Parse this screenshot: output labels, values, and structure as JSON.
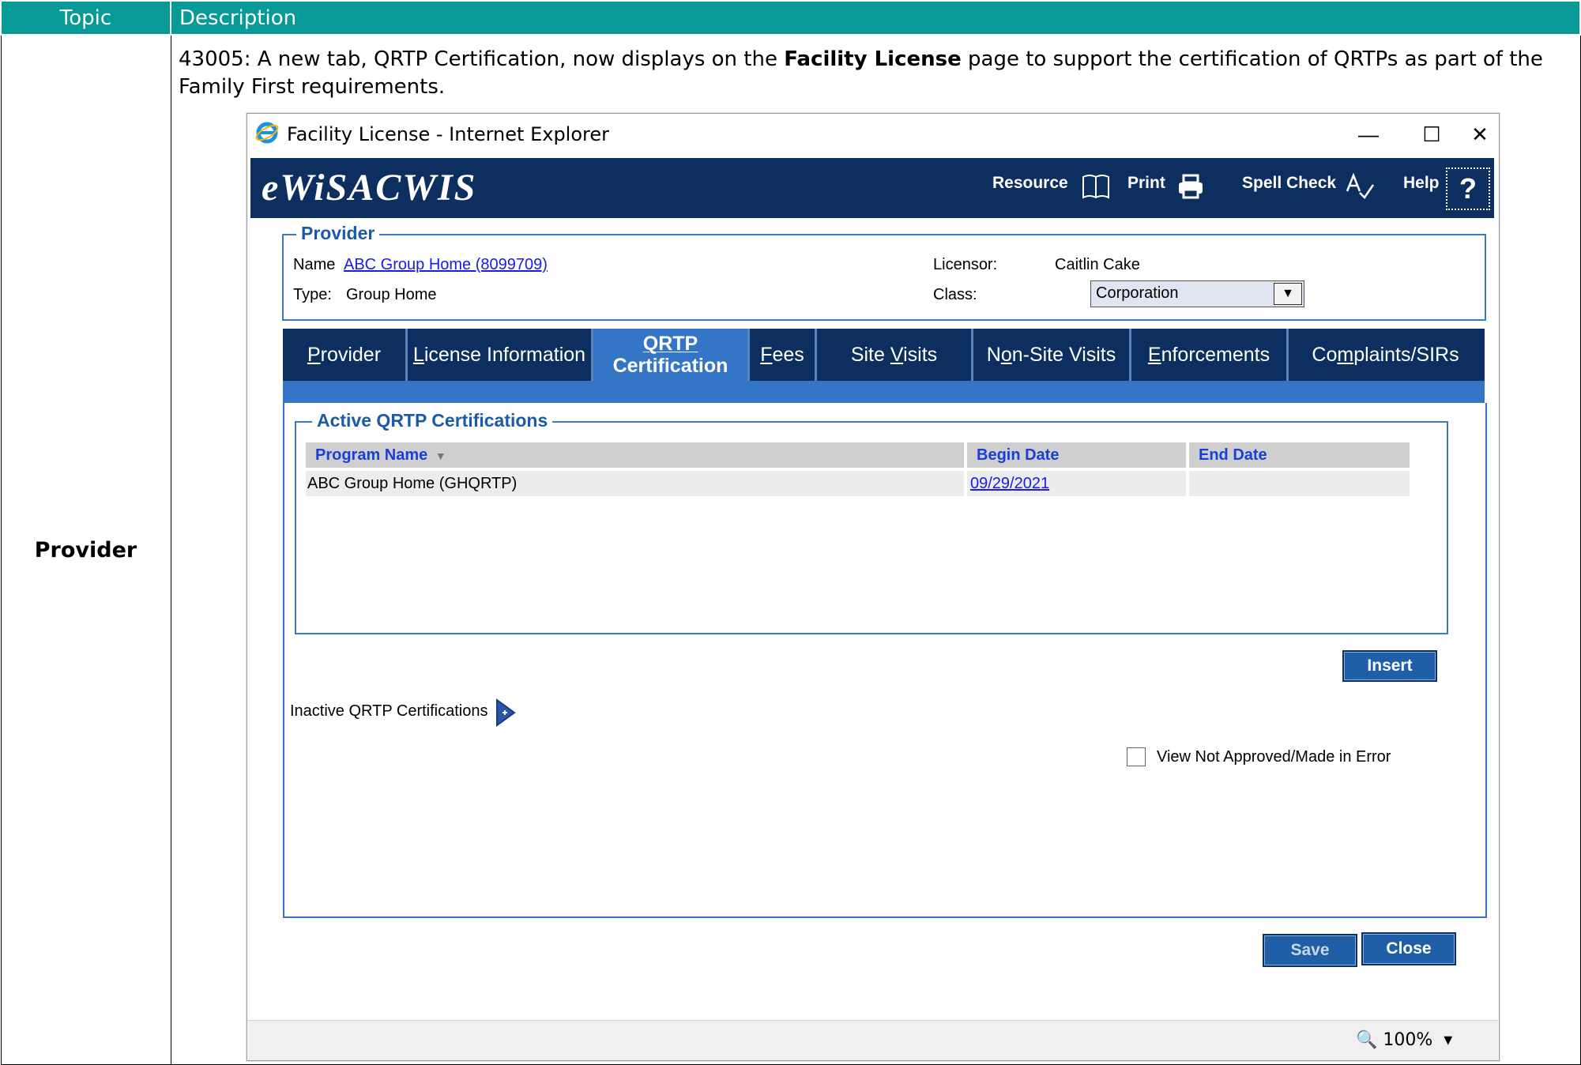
{
  "doc": {
    "header": {
      "topic": "Topic",
      "description": "Description"
    },
    "topic": "Provider",
    "description_prefix": "43005: A new tab, QRTP Certification, now displays on the ",
    "description_bold": "Facility License",
    "description_suffix": " page to support the certification of QRTPs as part of the Family First requirements."
  },
  "window": {
    "title": "Facility License - Internet Explorer",
    "controls": {
      "minimize": "—",
      "maximize": "☐",
      "close": "✕"
    }
  },
  "banner": {
    "logo": "eWiSACWIS",
    "resource": "Resource",
    "print": "Print",
    "spell_check": "Spell Check",
    "help": "Help",
    "help_glyph": "?"
  },
  "provider": {
    "legend": "Provider",
    "name_label": "Name",
    "name_link": "ABC Group Home  (8099709)",
    "type_label": "Type:",
    "type_value": "Group Home",
    "licensor_label": "Licensor:",
    "licensor_value": "Caitlin Cake",
    "class_label": "Class:",
    "class_value": "Corporation"
  },
  "tabs": [
    {
      "label": "Provider",
      "key": "P",
      "rest": "rovider"
    },
    {
      "label": "License Information",
      "key": "L",
      "rest": "icense Information"
    },
    {
      "label_line1": "QRTP",
      "label_line2": "Certification",
      "active": true
    },
    {
      "label": "Fees",
      "key": "F",
      "rest": "ees"
    },
    {
      "label": "Site Visits",
      "pre": "Site ",
      "key": "V",
      "rest": "isits"
    },
    {
      "label": "Non-Site Visits",
      "pre": "N",
      "key": "o",
      "rest": "n-Site Visits"
    },
    {
      "label": "Enforcements",
      "key": "E",
      "rest": "nforcements"
    },
    {
      "label": "Complaints/SIRs",
      "pre": "Co",
      "key": "m",
      "rest": "plaints/SIRs"
    }
  ],
  "active_certs": {
    "legend": "Active QRTP Certifications",
    "columns": [
      "Program Name",
      "Begin Date",
      "End Date"
    ],
    "rows": [
      {
        "program": "ABC Group Home (GHQRTP)",
        "begin": "09/29/2021",
        "end": ""
      }
    ]
  },
  "insert_button": "Insert",
  "inactive_label": "Inactive QRTP Certifications",
  "view_checkbox_label": "View Not Approved/Made in Error",
  "save_button": "Save",
  "close_button": "Close",
  "status": {
    "zoom": "100%"
  },
  "colors": {
    "banner": "#0d2f60",
    "active_tab": "#3575c5",
    "header": "#079a96"
  }
}
